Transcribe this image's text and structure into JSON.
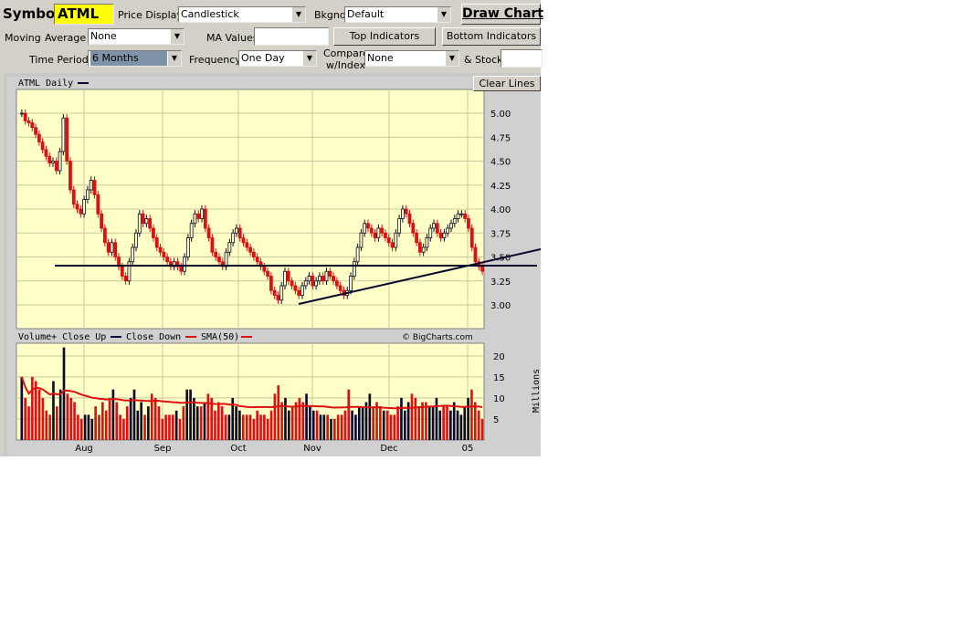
{
  "form": {
    "symbol_label": "Symbol",
    "symbol_value": "ATML",
    "price_display_label": "Price Display",
    "price_display_value": "Candlestick",
    "bkgnd_label": "Bkgnd",
    "bkgnd_value": "Default",
    "draw_chart_label": "Draw Chart",
    "moving_label": "Moving",
    "average_label": "Average",
    "moving_average_value": "None",
    "ma_values_label": "MA Values",
    "ma_values_value": "",
    "top_indicators_label": "Top Indicators",
    "bottom_indicators_label": "Bottom Indicators",
    "time_period_label": "Time Period:",
    "time_period_value": "6 Months",
    "frequency_label": "Frequency",
    "frequency_value": "One Day",
    "compare_label_1": "Compare",
    "compare_label_2": "w/Index",
    "compare_value": "None",
    "and_stock_label": "& Stock",
    "and_stock_value": ""
  },
  "chart": {
    "clear_lines_label": "Clear Lines",
    "price_title": "ATML Daily",
    "volume_title": "Volume+ Close Up",
    "close_down_label": "Close Down",
    "sma_label": "SMA(50)",
    "credit": "© BigCharts.com",
    "volume_unit": "Millions",
    "colors": {
      "up": "#0a0a2e",
      "down": "#dd1111",
      "sma": "#dd1111",
      "plot_bg": "#ffffc8",
      "trendline": "#0a0a2e"
    }
  },
  "chart_data": [
    {
      "type": "candlestick",
      "title": "ATML Daily",
      "x_ticks": [
        "Aug",
        "Sep",
        "Oct",
        "Nov",
        "Dec",
        "05"
      ],
      "y_ticks": [
        "5.00",
        "4.75",
        "4.50",
        "4.25",
        "4.00",
        "3.75",
        "3.50",
        "3.25",
        "3.00"
      ],
      "ylim": [
        2.9,
        5.25
      ],
      "grid": true,
      "closes": [
        5.0,
        4.92,
        4.9,
        4.85,
        4.78,
        4.7,
        4.62,
        4.55,
        4.48,
        4.5,
        4.4,
        4.6,
        4.95,
        4.5,
        4.2,
        4.05,
        4.0,
        3.95,
        4.1,
        4.2,
        4.3,
        4.15,
        3.95,
        3.8,
        3.65,
        3.55,
        3.65,
        3.5,
        3.4,
        3.3,
        3.25,
        3.45,
        3.6,
        3.75,
        3.95,
        3.85,
        3.9,
        3.8,
        3.7,
        3.6,
        3.55,
        3.5,
        3.45,
        3.4,
        3.45,
        3.4,
        3.35,
        3.5,
        3.7,
        3.85,
        3.95,
        3.9,
        4.0,
        3.8,
        3.7,
        3.55,
        3.5,
        3.45,
        3.4,
        3.55,
        3.65,
        3.75,
        3.8,
        3.7,
        3.65,
        3.6,
        3.55,
        3.5,
        3.45,
        3.4,
        3.35,
        3.3,
        3.15,
        3.1,
        3.05,
        3.2,
        3.35,
        3.25,
        3.2,
        3.15,
        3.1,
        3.2,
        3.25,
        3.3,
        3.2,
        3.25,
        3.3,
        3.25,
        3.35,
        3.3,
        3.25,
        3.2,
        3.15,
        3.1,
        3.15,
        3.3,
        3.45,
        3.6,
        3.75,
        3.85,
        3.8,
        3.75,
        3.7,
        3.8,
        3.75,
        3.7,
        3.65,
        3.6,
        3.75,
        3.9,
        4.0,
        3.95,
        3.85,
        3.75,
        3.65,
        3.55,
        3.6,
        3.7,
        3.8,
        3.85,
        3.75,
        3.7,
        3.75,
        3.8,
        3.85,
        3.9,
        3.95,
        3.95,
        3.9,
        3.8,
        3.6,
        3.45,
        3.4,
        3.35
      ]
    },
    {
      "type": "bar",
      "title": "Volume",
      "y_ticks": [
        "20",
        "15",
        "10",
        "5"
      ],
      "ylim": [
        0,
        23
      ],
      "unit": "Millions",
      "sma_name": "SMA(50)",
      "values": [
        15,
        10,
        8,
        15,
        14,
        12,
        10,
        7,
        6,
        14,
        8,
        12,
        22,
        11,
        10,
        9,
        6,
        5,
        6,
        6,
        5,
        8,
        6,
        9,
        7,
        10,
        12,
        9,
        6,
        5,
        8,
        10,
        12,
        7,
        9,
        6,
        8,
        11,
        10,
        8,
        5,
        6,
        6,
        6,
        7,
        5,
        8,
        12,
        12,
        10,
        8,
        8,
        9,
        11,
        10,
        7,
        9,
        8,
        6,
        6,
        10,
        8,
        7,
        6,
        6,
        6,
        5,
        7,
        6,
        6,
        5,
        7,
        11,
        13,
        9,
        10,
        7,
        8,
        9,
        10,
        9,
        11,
        8,
        7,
        7,
        6,
        6,
        6,
        5,
        5,
        6,
        6,
        7,
        12,
        7,
        6,
        8,
        8,
        9,
        11,
        8,
        9,
        8,
        7,
        7,
        6,
        6,
        8,
        10,
        7,
        9,
        11,
        10,
        8,
        9,
        9,
        8,
        8,
        10,
        7,
        8,
        8,
        7,
        9,
        7,
        6,
        8,
        10,
        12,
        9,
        7,
        5
      ]
    }
  ]
}
